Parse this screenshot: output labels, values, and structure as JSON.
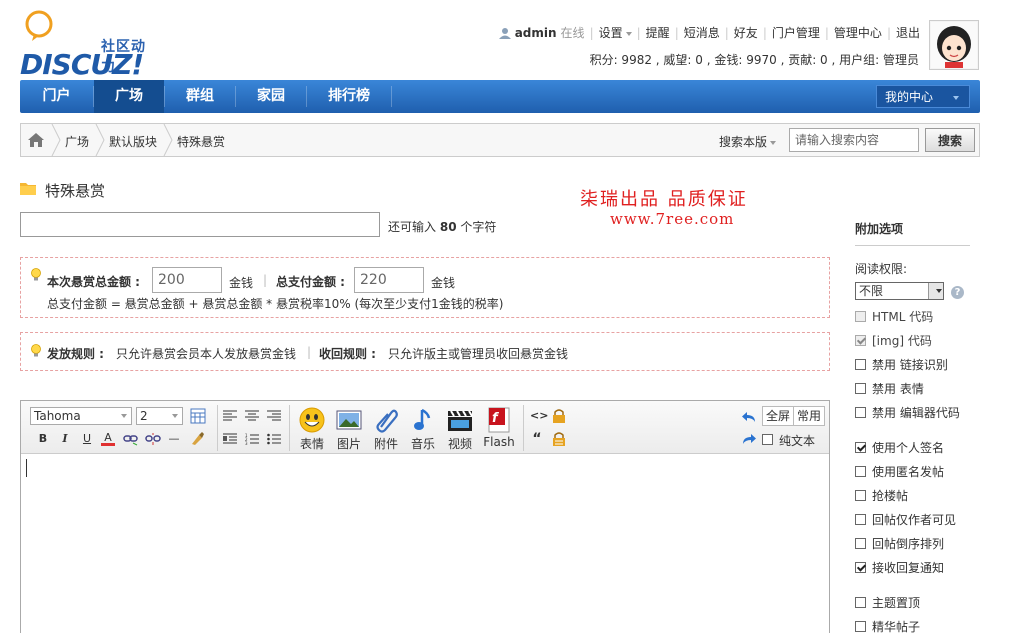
{
  "logo": {
    "subtitle": "社区动力",
    "brand": "DISCUZ!"
  },
  "topnav": {
    "username": "admin",
    "status": "在线",
    "links": [
      "设置",
      "提醒",
      "短消息",
      "好友",
      "门户管理",
      "管理中心",
      "退出"
    ],
    "stats": "积分: 9982 , 威望: 0 , 金钱: 9970 , 贡献: 0 , 用户组: 管理员"
  },
  "mainnav": {
    "items": [
      "门户",
      "广场",
      "群组",
      "家园",
      "排行榜"
    ],
    "active": "广场",
    "my_center": "我的中心"
  },
  "breadcrumb": {
    "items": [
      "广场",
      "默认版块",
      "特殊悬赏"
    ],
    "search_scope": "搜索本版",
    "search_placeholder": "请输入搜索内容",
    "search_button": "搜索"
  },
  "page": {
    "title": "特殊悬赏",
    "promo_line1": "柒瑞出品  品质保证",
    "promo_line2": "www.7ree.com",
    "char_remain_prefix": "还可输入",
    "char_remain_count": "80",
    "char_remain_suffix": "个字符"
  },
  "reward": {
    "total_label": "本次悬赏总金额 :",
    "total_value": "200",
    "unit1": "金钱",
    "pay_label": "总支付金额 :",
    "pay_value": "220",
    "unit2": "金钱",
    "formula": "总支付金额 = 悬赏总金额 + 悬赏总金额 * 悬赏税率10% (每次至少支付1金钱的税率)",
    "release_label": "发放规则 :",
    "release_text": "只允许悬赏会员本人发放悬赏金钱",
    "recycle_label": "收回规则 :",
    "recycle_text": "只允许版主或管理员收回悬赏金钱"
  },
  "editor": {
    "font": "Tahoma",
    "size": "2",
    "big_buttons": [
      "表情",
      "图片",
      "附件",
      "音乐",
      "视频",
      "Flash"
    ],
    "fullscreen": "全屏",
    "common": "常用",
    "plain_text": "纯文本"
  },
  "sidebar": {
    "title": "附加选项",
    "read_label": "阅读权限:",
    "read_value": "不限",
    "options": [
      {
        "label": "HTML 代码",
        "checked": false,
        "disabled": true
      },
      {
        "label": "[img] 代码",
        "checked": true,
        "disabled": true
      },
      {
        "label": "禁用 链接识别",
        "checked": false,
        "disabled": false
      },
      {
        "label": "禁用 表情",
        "checked": false,
        "disabled": false
      },
      {
        "label": "禁用 编辑器代码",
        "checked": false,
        "disabled": false
      },
      {
        "label": "使用个人签名",
        "checked": true,
        "disabled": false
      },
      {
        "label": "使用匿名发帖",
        "checked": false,
        "disabled": false
      },
      {
        "label": "抢楼帖",
        "checked": false,
        "disabled": false
      },
      {
        "label": "回帖仅作者可见",
        "checked": false,
        "disabled": false
      },
      {
        "label": "回帖倒序排列",
        "checked": false,
        "disabled": false
      },
      {
        "label": "接收回复通知",
        "checked": true,
        "disabled": false
      },
      {
        "label": "主题置顶",
        "checked": false,
        "disabled": false
      },
      {
        "label": "精华帖子",
        "checked": false,
        "disabled": false
      }
    ]
  },
  "colors": {
    "nav_blue": "#1f5fae",
    "promo_red": "#e02020",
    "dashed_border": "#e7a2a2"
  }
}
